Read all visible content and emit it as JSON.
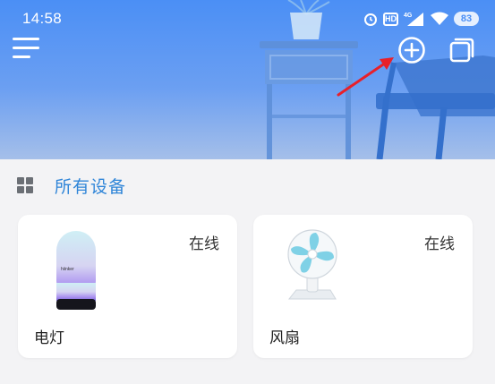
{
  "status_bar": {
    "time": "14:58",
    "network": "4G",
    "battery": "83"
  },
  "toolbar": {
    "menu_icon": "hamburger-menu-icon",
    "add_icon": "circle-plus-icon",
    "layers_icon": "layers-icon"
  },
  "section": {
    "title": "所有设备",
    "icon": "grid-icon"
  },
  "devices": [
    {
      "name": "电灯",
      "status": "在线",
      "icon": "lamp-image"
    },
    {
      "name": "风扇",
      "status": "在线",
      "icon": "fan-image"
    }
  ],
  "colors": {
    "banner_top": "#4b8ff5",
    "banner_bottom": "#a5bfe9",
    "accent": "#2f85d8",
    "annotation_arrow": "#e8202a",
    "background": "#f3f3f5"
  }
}
